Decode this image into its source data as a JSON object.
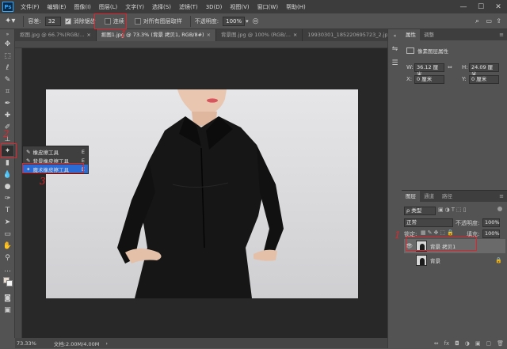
{
  "menubar": {
    "logo": "Ps",
    "items": [
      "文件(F)",
      "编辑(E)",
      "图像(I)",
      "图层(L)",
      "文字(Y)",
      "选择(S)",
      "滤镜(T)",
      "3D(D)",
      "视图(V)",
      "窗口(W)",
      "帮助(H)"
    ]
  },
  "window_controls": {
    "minimize": "—",
    "maximize": "☐",
    "close": "✕"
  },
  "options": {
    "tolerance_label": "容差:",
    "tolerance_value": "32",
    "antialias_label": "消除锯齿",
    "contiguous_label": "连续",
    "sample_all_label": "对所有图层取样",
    "opacity_label": "不透明度:",
    "opacity_value": "100%"
  },
  "tabs": [
    {
      "label": "抠图.jpg @ 66.7%(RGB/...",
      "close": "×",
      "active": false
    },
    {
      "label": "抠图1.jpg @ 73.3% (背景 拷贝1, RGB/8#)",
      "close": "×",
      "active": true
    },
    {
      "label": "背景图.jpg @ 100% (RGB/...",
      "close": "×",
      "active": false
    },
    {
      "label": "19930301_185220695723_2.jp...",
      "close": "",
      "active": false
    }
  ],
  "tabs_overflow": "»",
  "tool_flyout": [
    {
      "icon": "✎",
      "label": "橡皮擦工具",
      "key": "E",
      "selected": false
    },
    {
      "icon": "✎",
      "label": "背景橡皮擦工具",
      "key": "E",
      "selected": false
    },
    {
      "icon": "✦",
      "label": "魔术橡皮擦工具",
      "key": "E",
      "selected": true
    }
  ],
  "status": {
    "zoom": "73.33%",
    "doc": "文档:2.00M/4.00M",
    "arrow": "›"
  },
  "properties_panel": {
    "tab_properties": "属性",
    "tab_adjustments": "调整",
    "subtitle": "像素图层属性",
    "w_label": "W:",
    "w_value": "36.12 厘米",
    "link": "⇔",
    "h_label": "H:",
    "h_value": "24.09 厘米",
    "x_label": "X:",
    "x_value": "0 厘米",
    "y_label": "Y:",
    "y_value": "0 厘米"
  },
  "layers_panel": {
    "tab_layers": "图层",
    "tab_channels": "通道",
    "tab_paths": "路径",
    "filter_kind": "ρ 类型",
    "blend_mode": "正常",
    "opacity_label": "不透明度:",
    "opacity_value": "100%",
    "lock_label": "锁定:",
    "fill_label": "填充:",
    "fill_value": "100%",
    "layers": [
      {
        "name": "背景 拷贝1",
        "visible": true,
        "selected": true,
        "locked": false
      },
      {
        "name": "背景",
        "visible": false,
        "selected": false,
        "locked": true
      }
    ],
    "footer_icons": [
      "⇔",
      "fx",
      "◘",
      "◑",
      "▣",
      "▢",
      "🗑"
    ]
  },
  "annotations": [
    {
      "mark": "1",
      "target": "contiguous checkbox"
    },
    {
      "mark": "2",
      "target": "eraser tool"
    },
    {
      "mark": "3",
      "target": "magic eraser tool"
    },
    {
      "mark": "1",
      "target": "background copy layer"
    }
  ],
  "colors": {
    "accent_blue": "#2a6bd6",
    "annotation_red": "#e0262c",
    "panel_bg": "#535353"
  }
}
